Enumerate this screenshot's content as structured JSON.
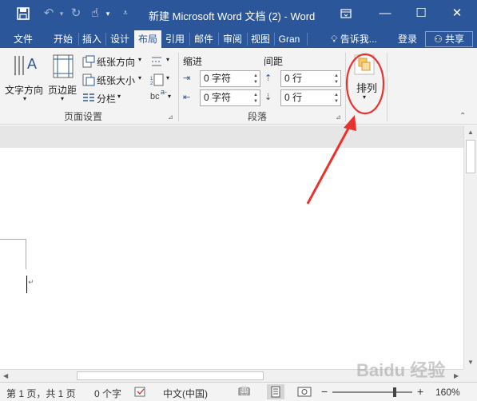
{
  "window": {
    "title": "新建 Microsoft Word 文档 (2) - Word",
    "minimize_icon": "minimize-icon",
    "restore_icon": "restore-icon",
    "close_icon": "close-icon"
  },
  "tabs": [
    {
      "label": "文件"
    },
    {
      "label": "开始"
    },
    {
      "label": "插入"
    },
    {
      "label": "设计"
    },
    {
      "label": "布局"
    },
    {
      "label": "引用"
    },
    {
      "label": "邮件"
    },
    {
      "label": "审阅"
    },
    {
      "label": "视图"
    },
    {
      "label": "Gran"
    }
  ],
  "tell_me": "告诉我...",
  "signin": "登录",
  "share": "共享",
  "ribbon": {
    "page_setup": {
      "text_direction": "文字方向",
      "margins": "页边距",
      "orientation": "纸张方向",
      "size": "纸张大小",
      "columns": "分栏",
      "group_label": "页面设置"
    },
    "paragraph": {
      "indent_label": "缩进",
      "spacing_label": "间距",
      "indent_left": "0 字符",
      "indent_right": "0 字符",
      "spacing_before": "0 行",
      "spacing_after": "0 行",
      "group_label": "段落"
    },
    "arrange": {
      "label": "排列"
    }
  },
  "status": {
    "page": "第 1 页，共 1 页",
    "words": "0 个字",
    "language": "中文(中国)",
    "zoom": "160%"
  },
  "annotation": {
    "color": "#e8322e"
  },
  "watermark": {
    "text": "Baidu 经验"
  }
}
